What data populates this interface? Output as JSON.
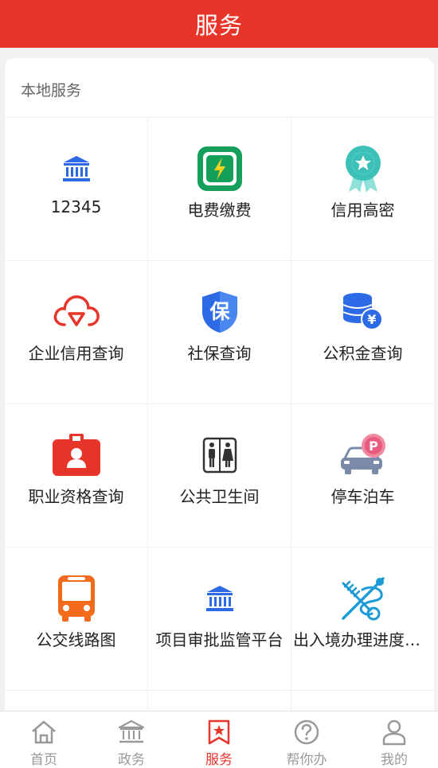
{
  "header": {
    "title": "服务"
  },
  "section": {
    "title": "本地服务"
  },
  "services": [
    {
      "label": "12345",
      "icon": "bank-icon"
    },
    {
      "label": "电费缴费",
      "icon": "electricity-icon"
    },
    {
      "label": "信用高密",
      "icon": "credit-badge-icon"
    },
    {
      "label": "企业信用查询",
      "icon": "cloud-shield-icon"
    },
    {
      "label": "社保查询",
      "icon": "social-security-icon"
    },
    {
      "label": "公积金查询",
      "icon": "coins-yuan-icon"
    },
    {
      "label": "职业资格查询",
      "icon": "id-badge-icon"
    },
    {
      "label": "公共卫生间",
      "icon": "restroom-icon"
    },
    {
      "label": "停车泊车",
      "icon": "parking-car-icon"
    },
    {
      "label": "公交线路图",
      "icon": "bus-icon"
    },
    {
      "label": "项目审批监管平台",
      "icon": "bank-icon"
    },
    {
      "label": "出入境办理进度查询",
      "icon": "immigration-icon"
    }
  ],
  "tabs": [
    {
      "label": "首页",
      "icon": "home-icon",
      "active": false
    },
    {
      "label": "政务",
      "icon": "government-icon",
      "active": false
    },
    {
      "label": "服务",
      "icon": "star-bookmark-icon",
      "active": true
    },
    {
      "label": "帮你办",
      "icon": "help-icon",
      "active": false
    },
    {
      "label": "我的",
      "icon": "user-icon",
      "active": false
    }
  ],
  "colors": {
    "brand_red": "#e8352a",
    "blue": "#2d6be6",
    "teal": "#3cc1b8",
    "green": "#14a05a",
    "orange": "#f26a1b",
    "inactive": "#999999"
  }
}
